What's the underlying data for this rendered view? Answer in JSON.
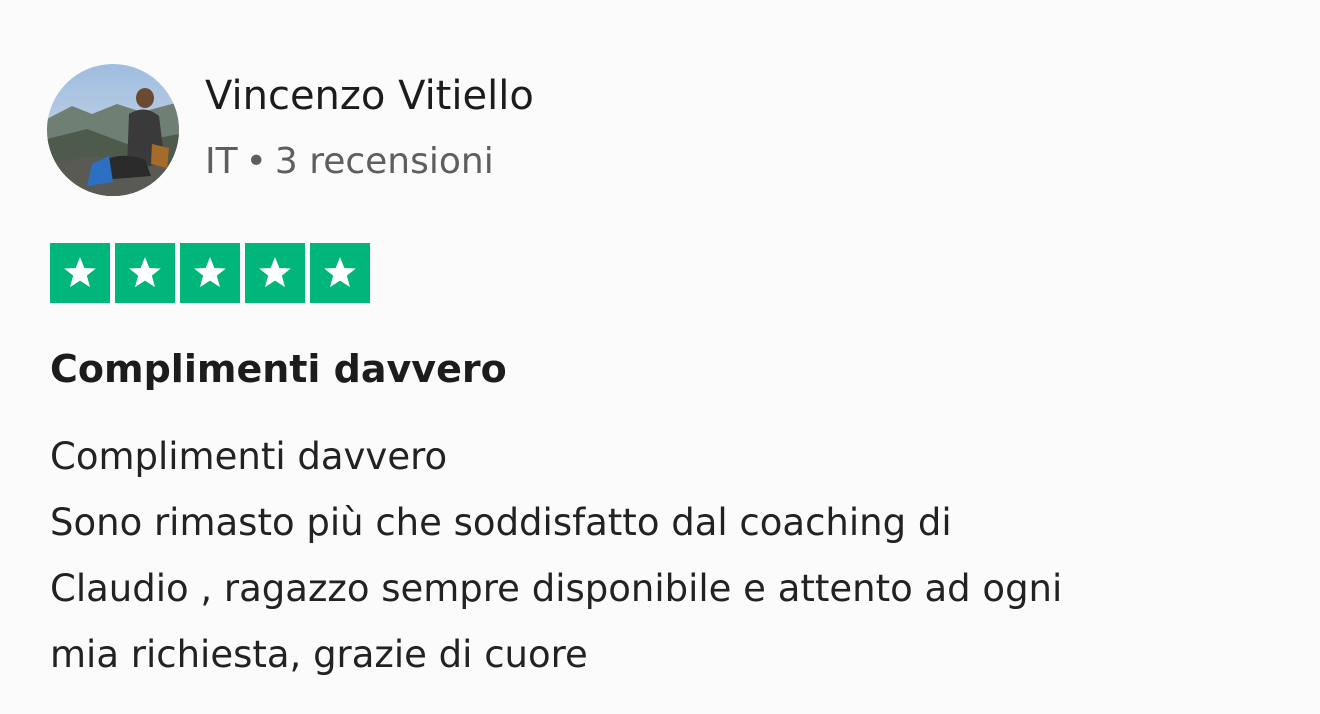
{
  "reviewer": {
    "name": "Vincenzo Vitiello",
    "country": "IT",
    "separator": "•",
    "review_count": "3 recensioni"
  },
  "rating": {
    "stars": 5,
    "max_stars": 5,
    "color": "#00b67a",
    "icon": "star-icon"
  },
  "review": {
    "title": "Complimenti davvero",
    "body_lines": [
      "Complimenti davvero",
      "Sono rimasto più che soddisfatto dal coaching di",
      "Claudio , ragazzo sempre disponibile e attento ad ogni",
      "mia richiesta, grazie di cuore"
    ]
  }
}
